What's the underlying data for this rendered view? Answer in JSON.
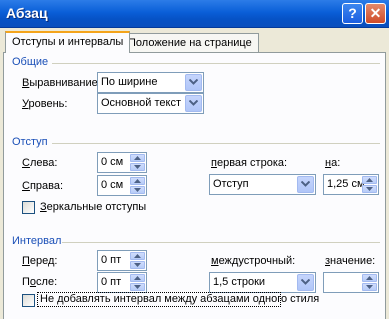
{
  "window": {
    "title": "Абзац",
    "help_button": "?",
    "close_button": "✕"
  },
  "tabs": [
    {
      "label": "Отступы и интервалы",
      "active": true
    },
    {
      "label": "Положение на странице",
      "active": false
    }
  ],
  "general": {
    "title": "Общие",
    "alignment_label": "Выравнивание:",
    "alignment_value": "По ширине",
    "level_label": "Уровень:",
    "level_value": "Основной текст"
  },
  "indent": {
    "title": "Отступ",
    "left_label": "Слева:",
    "left_value": "0 см",
    "right_label": "Справа:",
    "right_value": "0 см",
    "first_line_label": "первая строка:",
    "first_line_value": "Отступ",
    "by_label": "на:",
    "by_value": "1,25 см",
    "mirror_label": "Зеркальные отступы",
    "mirror_checked": false
  },
  "spacing": {
    "title": "Интервал",
    "before_label": "Перед:",
    "before_value": "0 пт",
    "after_label": "После:",
    "after_value": "0 пт",
    "line_spacing_label": "междустрочный:",
    "line_spacing_value": "1,5 строки",
    "at_label": "значение:",
    "at_value": "",
    "no_space_label": "Не добавлять интервал между абзацами одного стиля",
    "no_space_checked": false
  }
}
